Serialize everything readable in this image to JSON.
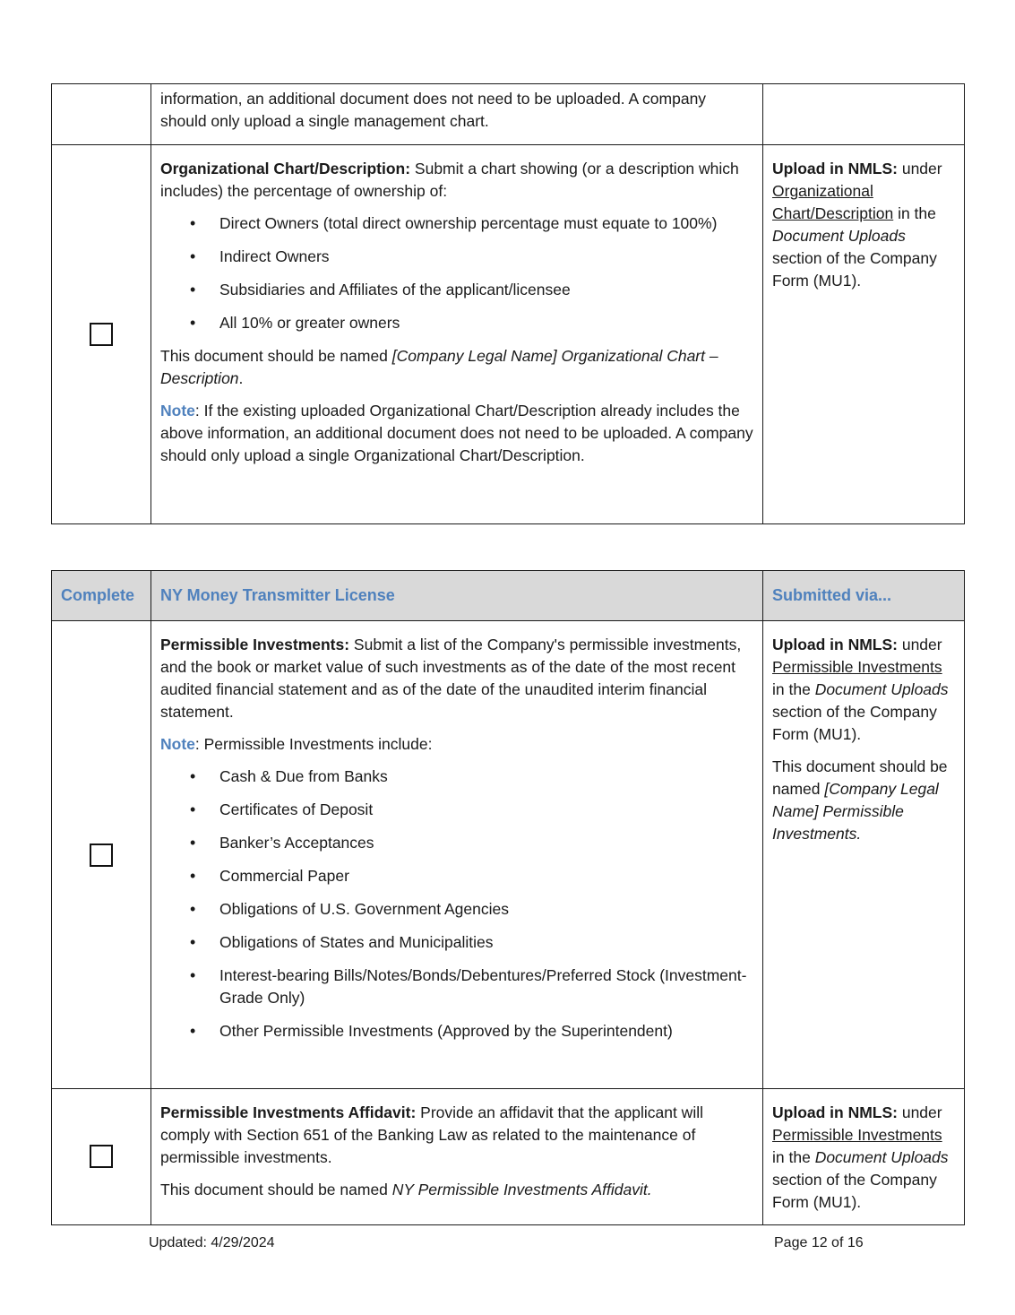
{
  "table1": {
    "row0": {
      "text": "information, an additional document does not need to be uploaded. A company should only upload a single management chart."
    },
    "row1": {
      "checkbox_checked": false,
      "title": "Organizational Chart/Description:",
      "intro": " Submit a chart showing (or a description which includes) the percentage of ownership of:",
      "bullets": [
        "Direct Owners (total direct ownership percentage must equate to 100%)",
        "Indirect Owners",
        "Subsidiaries and Affiliates of the applicant/licensee",
        "All 10% or greater owners"
      ],
      "naming_prefix": "This document should be named ",
      "naming_name": "[Company Legal Name] Organizational Chart – Description",
      "naming_suffix": ".",
      "note_label": "Note",
      "note_text": ": If the existing uploaded Organizational Chart/Description already includes the above information, an additional document does not need to be uploaded. A company should only upload a single Organizational Chart/Description.",
      "submit_bold": "Upload in NMLS:",
      "submit_under": " under ",
      "submit_link": "Organizational Chart/Description",
      "submit_in": " in the ",
      "submit_section": "Document Uploads",
      "submit_rest": " section of the Company Form (MU1)."
    }
  },
  "table2": {
    "header": {
      "complete": "Complete",
      "license": "NY Money Transmitter License",
      "submitted": "Submitted via..."
    },
    "row1": {
      "checkbox_checked": false,
      "title": "Permissible Investments:",
      "intro": " Submit a list of the Company's permissible investments, and the book or market value of such investments as of the date of the most recent audited financial statement and as of the date of the unaudited interim financial statement.",
      "note_label": "Note",
      "note_text": ": Permissible Investments include:",
      "bullets": [
        "Cash & Due from Banks",
        "Certificates of Deposit",
        "Banker’s Acceptances",
        "Commercial Paper",
        "Obligations of U.S. Government Agencies",
        "Obligations of States and Municipalities",
        "Interest-bearing Bills/Notes/Bonds/Debentures/Preferred Stock (Investment-Grade Only)",
        "Other Permissible Investments (Approved by the Superintendent)"
      ],
      "submit_bold": "Upload in NMLS:",
      "submit_under": " under ",
      "submit_link": "Permissible Investments",
      "submit_in": " in the ",
      "submit_section": "Document Uploads",
      "submit_rest": " section of the Company Form (MU1).",
      "naming_prefix": "This document should be named ",
      "naming_name": "[Company Legal Name] Permissible Investments."
    },
    "row2": {
      "checkbox_checked": false,
      "title": "Permissible Investments Affidavit:",
      "intro": " Provide an affidavit that the applicant will comply with Section 651 of the Banking Law as related to the maintenance of permissible investments.",
      "naming_prefix": "This document should be named ",
      "naming_name": "NY Permissible Investments Affidavit.",
      "submit_bold": "Upload in NMLS:",
      "submit_under": " under ",
      "submit_link": "Permissible Investments",
      "submit_in": " in the ",
      "submit_section": "Document Uploads",
      "submit_rest": " section of the Company Form (MU1)."
    }
  },
  "footer": {
    "updated": "Updated:  4/29/2024",
    "page": "Page 12 of 16"
  }
}
